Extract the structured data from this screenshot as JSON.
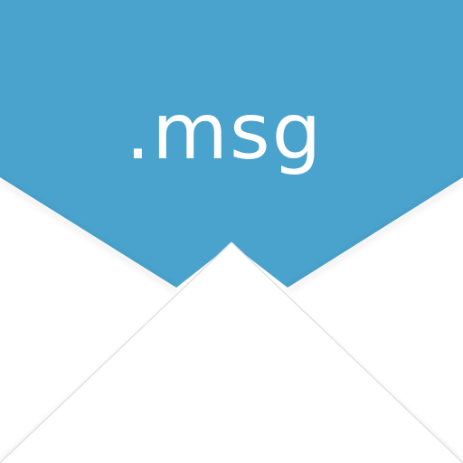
{
  "icon": {
    "label": ".msg",
    "name": "envelope-icon"
  },
  "colors": {
    "flap": "#4aa3cc",
    "paper": "#ffffff",
    "text": "#ffffff"
  }
}
